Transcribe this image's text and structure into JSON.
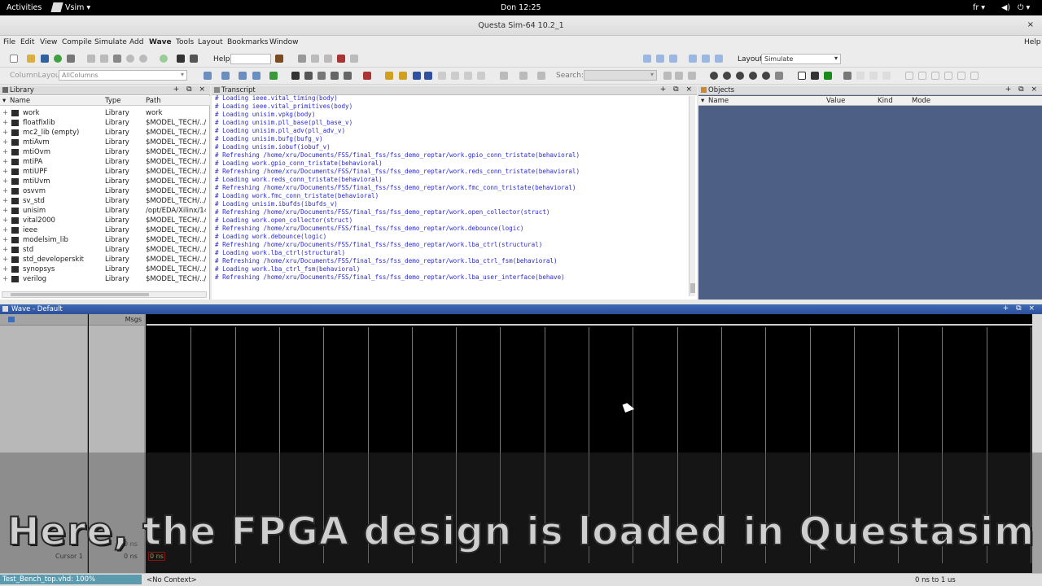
{
  "topbar": {
    "activities": "Activities",
    "app": "Vsim",
    "clock": "Don 12:25",
    "lang": "fr"
  },
  "window": {
    "title": "Questa Sim-64 10.2_1",
    "close": "×"
  },
  "menu": [
    "File",
    "Edit",
    "View",
    "Compile",
    "Simulate",
    "Add",
    "Wave",
    "Tools",
    "Layout",
    "Bookmarks",
    "Window"
  ],
  "menu_help": "Help",
  "toolbar": {
    "help_label": "Help",
    "layout_label": "Layout",
    "layout_value": "Simulate",
    "column_layout_label": "ColumnLayout",
    "column_layout_value": "AllColumns",
    "search_label": "Search:"
  },
  "library": {
    "title": "Library",
    "columns": [
      "Name",
      "Type",
      "Path"
    ],
    "rows": [
      {
        "name": "work",
        "type": "Library",
        "path": "work"
      },
      {
        "name": "floatfixlib",
        "type": "Library",
        "path": "$MODEL_TECH/../f"
      },
      {
        "name": "mc2_lib  (empty)",
        "type": "Library",
        "path": "$MODEL_TECH/../r"
      },
      {
        "name": "mtiAvm",
        "type": "Library",
        "path": "$MODEL_TECH/../a"
      },
      {
        "name": "mtiOvm",
        "type": "Library",
        "path": "$MODEL_TECH/../c"
      },
      {
        "name": "mtiPA",
        "type": "Library",
        "path": "$MODEL_TECH/../p"
      },
      {
        "name": "mtiUPF",
        "type": "Library",
        "path": "$MODEL_TECH/../i"
      },
      {
        "name": "mtiUvm",
        "type": "Library",
        "path": "$MODEL_TECH/../u"
      },
      {
        "name": "osvvm",
        "type": "Library",
        "path": "$MODEL_TECH/../c"
      },
      {
        "name": "sv_std",
        "type": "Library",
        "path": "$MODEL_TECH/../s"
      },
      {
        "name": "unisim",
        "type": "Library",
        "path": "/opt/EDA/Xilinx/14"
      },
      {
        "name": "vital2000",
        "type": "Library",
        "path": "$MODEL_TECH/../v"
      },
      {
        "name": "ieee",
        "type": "Library",
        "path": "$MODEL_TECH/../ie"
      },
      {
        "name": "modelsim_lib",
        "type": "Library",
        "path": "$MODEL_TECH/../r"
      },
      {
        "name": "std",
        "type": "Library",
        "path": "$MODEL_TECH/../s"
      },
      {
        "name": "std_developerskit",
        "type": "Library",
        "path": "$MODEL_TECH/../s"
      },
      {
        "name": "synopsys",
        "type": "Library",
        "path": "$MODEL_TECH/../s"
      },
      {
        "name": "verilog",
        "type": "Library",
        "path": "$MODEL_TECH/../v"
      }
    ]
  },
  "transcript": {
    "title": "Transcript",
    "lines": [
      "# Loading ieee.vital_timing(body)",
      "# Loading ieee.vital_primitives(body)",
      "# Loading unisim.vpkg(body)",
      "# Loading unisim.pll_base(pll_base_v)",
      "# Loading unisim.pll_adv(pll_adv_v)",
      "# Loading unisim.bufg(bufg_v)",
      "# Loading unisim.iobuf(iobuf_v)",
      "# Refreshing /home/xru/Documents/FSS/final_fss/fss_demo_reptar/work.gpio_conn_tristate(behavioral)",
      "# Loading work.gpio_conn_tristate(behavioral)",
      "# Refreshing /home/xru/Documents/FSS/final_fss/fss_demo_reptar/work.reds_conn_tristate(behavioral)",
      "# Loading work.reds_conn_tristate(behavioral)",
      "# Refreshing /home/xru/Documents/FSS/final_fss/fss_demo_reptar/work.fmc_conn_tristate(behavioral)",
      "# Loading work.fmc_conn_tristate(behavioral)",
      "# Loading unisim.ibufds(ibufds_v)",
      "# Refreshing /home/xru/Documents/FSS/final_fss/fss_demo_reptar/work.open_collector(struct)",
      "# Loading work.open_collector(struct)",
      "# Refreshing /home/xru/Documents/FSS/final_fss/fss_demo_reptar/work.debounce(logic)",
      "# Loading work.debounce(logic)",
      "# Refreshing /home/xru/Documents/FSS/final_fss/fss_demo_reptar/work.lba_ctrl(structural)",
      "# Loading work.lba_ctrl(structural)",
      "# Refreshing /home/xru/Documents/FSS/final_fss/fss_demo_reptar/work.lba_ctrl_fsm(behavioral)",
      "# Loading work.lba_ctrl_fsm(behavioral)",
      "# Refreshing /home/xru/Documents/FSS/final_fss/fss_demo_reptar/work.lba_user_interface(behave)"
    ]
  },
  "objects": {
    "title": "Objects",
    "columns": [
      "Name",
      "Value",
      "Kind",
      "Mode"
    ]
  },
  "wave": {
    "title": "Wave - Default",
    "msgs_label": "Msgs",
    "now_value": "0 ns",
    "cursor_label": "Cursor 1",
    "cursor_value": "0 ns",
    "cursor_time": "0 ns"
  },
  "status": {
    "file": "Test_Bench_top.vhd: 100%",
    "context": "<No Context>",
    "range": "0 ns to 1 us"
  },
  "caption": "Here, the FPGA design is loaded in Questasim"
}
